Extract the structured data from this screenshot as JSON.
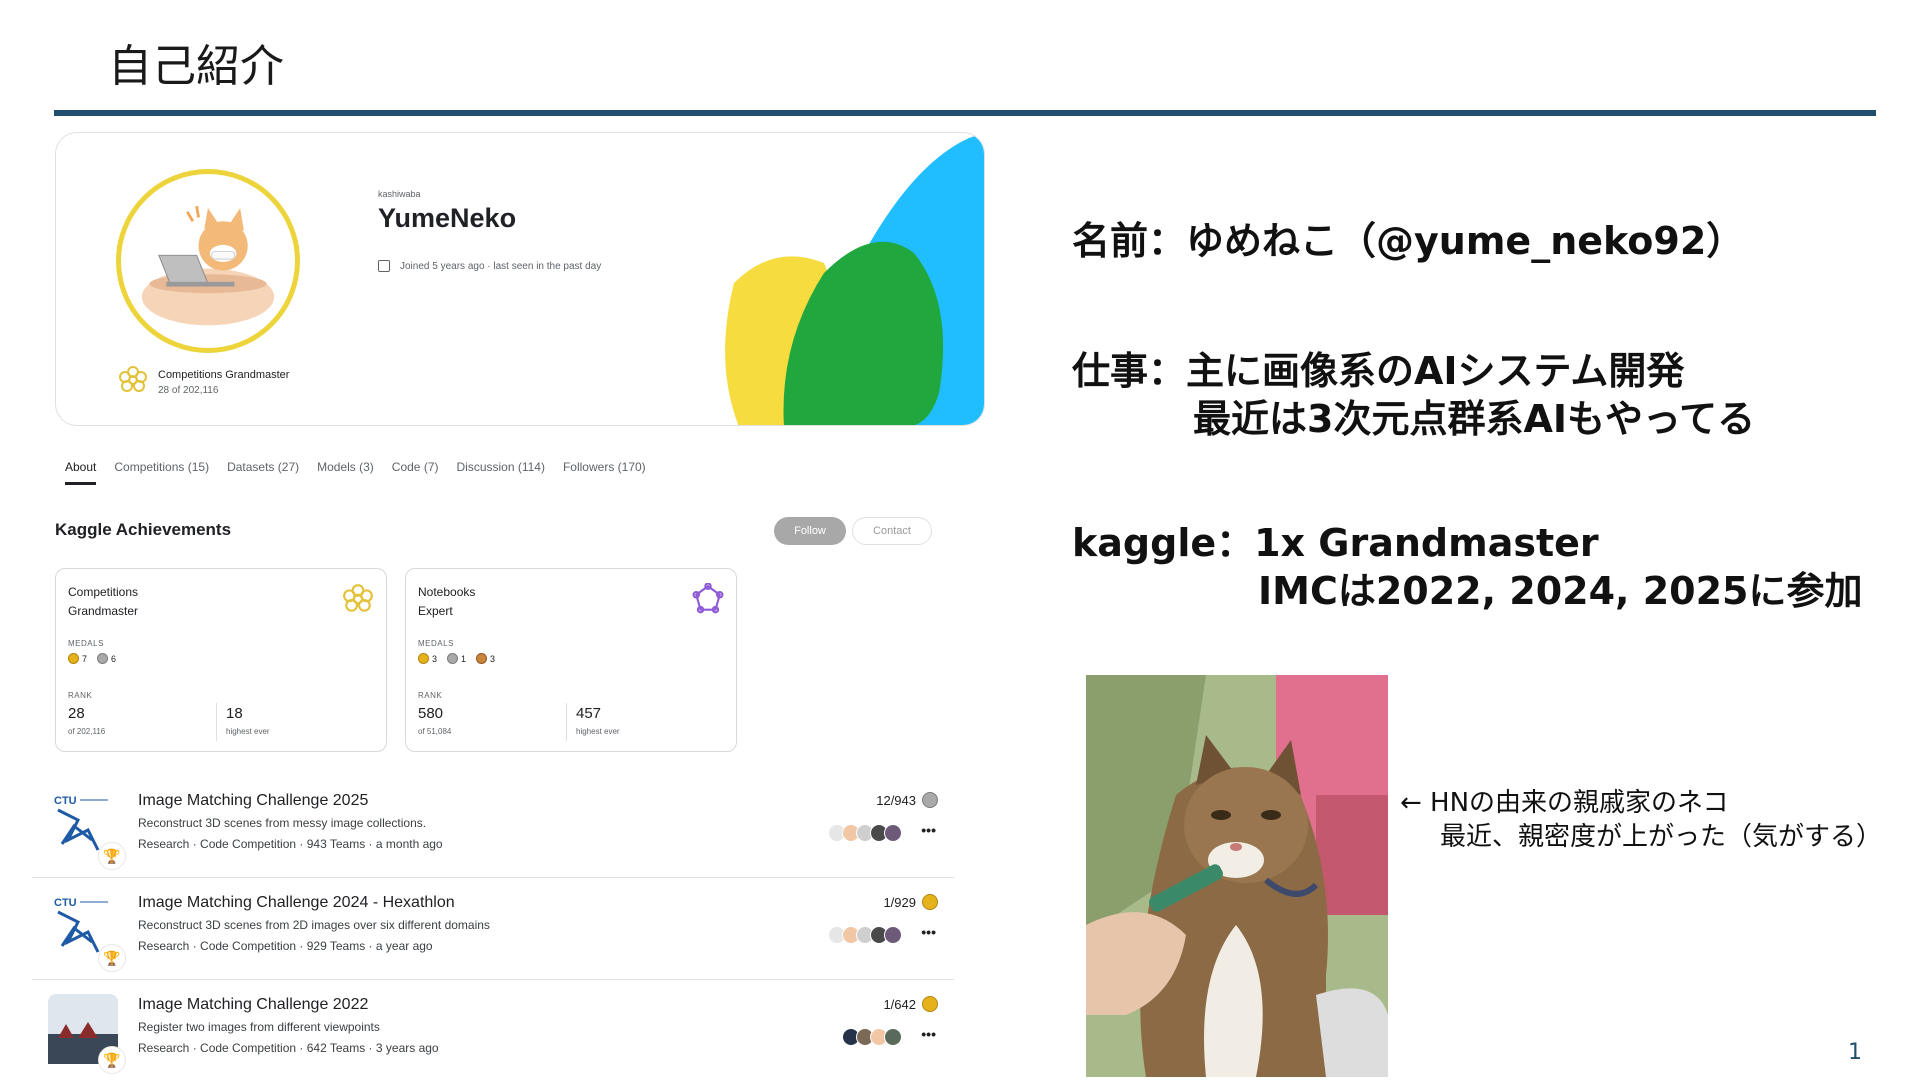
{
  "slide": {
    "title": "自己紹介",
    "page_number": "1"
  },
  "profile": {
    "handle": "kashiwaba",
    "display_name": "YumeNeko",
    "joined": "Joined 5 years ago · last seen in the past day",
    "tier_name": "Competitions Grandmaster",
    "tier_rank": "28 of 202,116"
  },
  "tabs": [
    "About",
    "Competitions (15)",
    "Datasets (27)",
    "Models (3)",
    "Code (7)",
    "Discussion (114)",
    "Followers (170)"
  ],
  "achievements": {
    "title": "Kaggle Achievements",
    "follow_label": "Follow",
    "contact_label": "Contact",
    "medals_label": "MEDALS",
    "rank_label": "RANK",
    "cards": [
      {
        "name_line1": "Competitions",
        "name_line2": "Grandmaster",
        "gold": "7",
        "silver": "6",
        "rank": "28",
        "rank_sub": "of 202,116",
        "highest": "18",
        "highest_sub": "highest ever"
      },
      {
        "name_line1": "Notebooks",
        "name_line2": "Expert",
        "gold": "3",
        "silver": "1",
        "bronze": "3",
        "rank": "580",
        "rank_sub": "of 51,084",
        "highest": "457",
        "highest_sub": "highest ever"
      }
    ]
  },
  "competitions": [
    {
      "title": "Image Matching Challenge 2025",
      "desc": "Reconstruct 3D scenes from messy image collections.",
      "meta": "Research · Code Competition · 943 Teams · a month ago",
      "rank": "12/943",
      "medal": "silver"
    },
    {
      "title": "Image Matching Challenge 2024 - Hexathlon",
      "desc": "Reconstruct 3D scenes from 2D images over six different domains",
      "meta": "Research · Code Competition · 929 Teams · a year ago",
      "rank": "1/929",
      "medal": "gold"
    },
    {
      "title": "Image Matching Challenge 2022",
      "desc": "Register two images from different viewpoints",
      "meta": "Research · Code Competition · 642 Teams · 3 years ago",
      "rank": "1/642",
      "medal": "gold"
    }
  ],
  "info": {
    "name": "名前：ゆめねこ（@yume_neko92）",
    "job_line1": "仕事：主に画像系のAIシステム開発",
    "job_line2": "最近は3次元点群系AIもやってる",
    "kaggle_line1": "kaggle：1x Grandmaster",
    "kaggle_line2": "IMCは2022, 2024, 2025に参加"
  },
  "cat": {
    "caption_line1": "← HNの由来の親戚家のネコ",
    "caption_line2": "最近、親密度が上がった（気がする）"
  },
  "colors": {
    "rule": "#1f4e6e",
    "gold": "#e5b21b",
    "silver": "#a9a9a9",
    "bronze": "#c9853b"
  }
}
